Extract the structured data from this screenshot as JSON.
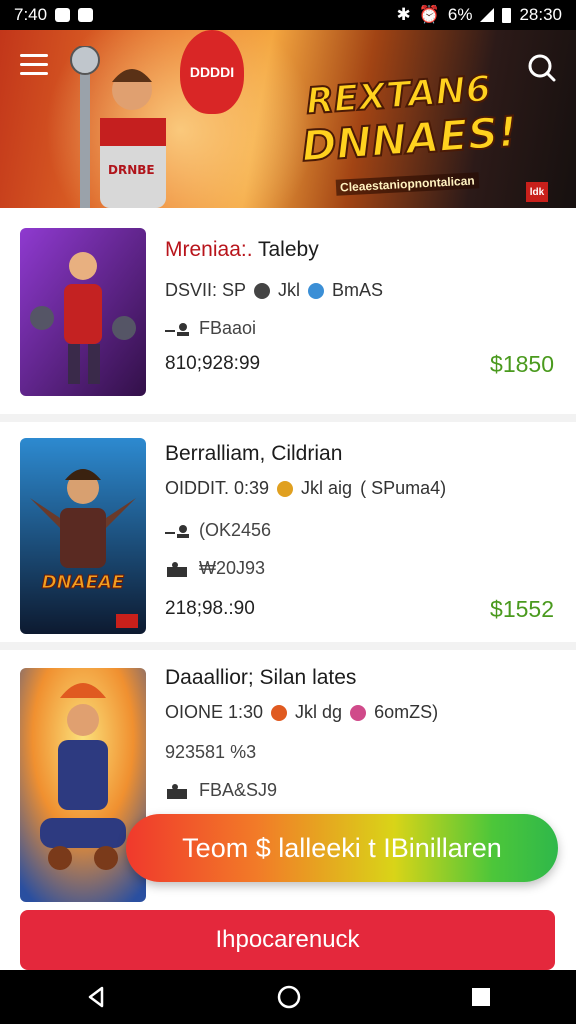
{
  "status_bar": {
    "time_left": "7:40",
    "battery_text": "6%",
    "time_right": "28:30"
  },
  "banner": {
    "balloon_text": "DDDDI",
    "title_line1": "REXTAN6",
    "title_line2": "DNNAES!",
    "tagline": "Cleaestaniopnontalican",
    "badge": "ldk"
  },
  "listings": [
    {
      "title_accent": "Mreniaa:.",
      "title_rest": " Taleby",
      "meta_text": "DSVII: SP",
      "meta_extra": "Jkl",
      "meta_tag": "BmAS",
      "row1_text": "FBaaoi",
      "date": "810;928:99",
      "price": "$1850",
      "thumb_colors": [
        "#7a2fb8",
        "#3a1758"
      ]
    },
    {
      "title_accent": "",
      "title_rest": "Berralliam, Cildrian",
      "meta_text": "OIDDIT. 0:39",
      "meta_extra": "Jkl aig",
      "meta_tag": "( SPuma4)",
      "row1_text": "(OK2456",
      "row2_text": "₩20J93",
      "date": "218;98.:90",
      "price": "$1552",
      "thumb_colors": [
        "#1e6fa8",
        "#0c1e35"
      ],
      "thumb_text": "DNAEAE"
    },
    {
      "title_accent": "",
      "title_rest": "Daaallior; Silan lates",
      "meta_text": "OIONE 1:30",
      "meta_extra": "Jkl dg",
      "meta_tag": "6omZS)",
      "red_text": "923581 %3",
      "row2_text": "FBA&SJ9",
      "thumb_colors": [
        "#f0a030",
        "#2a4fa0"
      ]
    }
  ],
  "floating_pill": {
    "label": "Teom $ lalleeki t IBinillaren"
  },
  "bottom_cta": {
    "label": "Ihpocarenuck"
  },
  "icons": {
    "menu": "hamburger-icon",
    "search": "search-icon",
    "back": "back-icon",
    "home": "home-icon",
    "recents": "recents-icon"
  },
  "colors": {
    "price_green": "#4a9a1e",
    "cta_red": "#e4283c",
    "accent_red": "#b8141b"
  }
}
